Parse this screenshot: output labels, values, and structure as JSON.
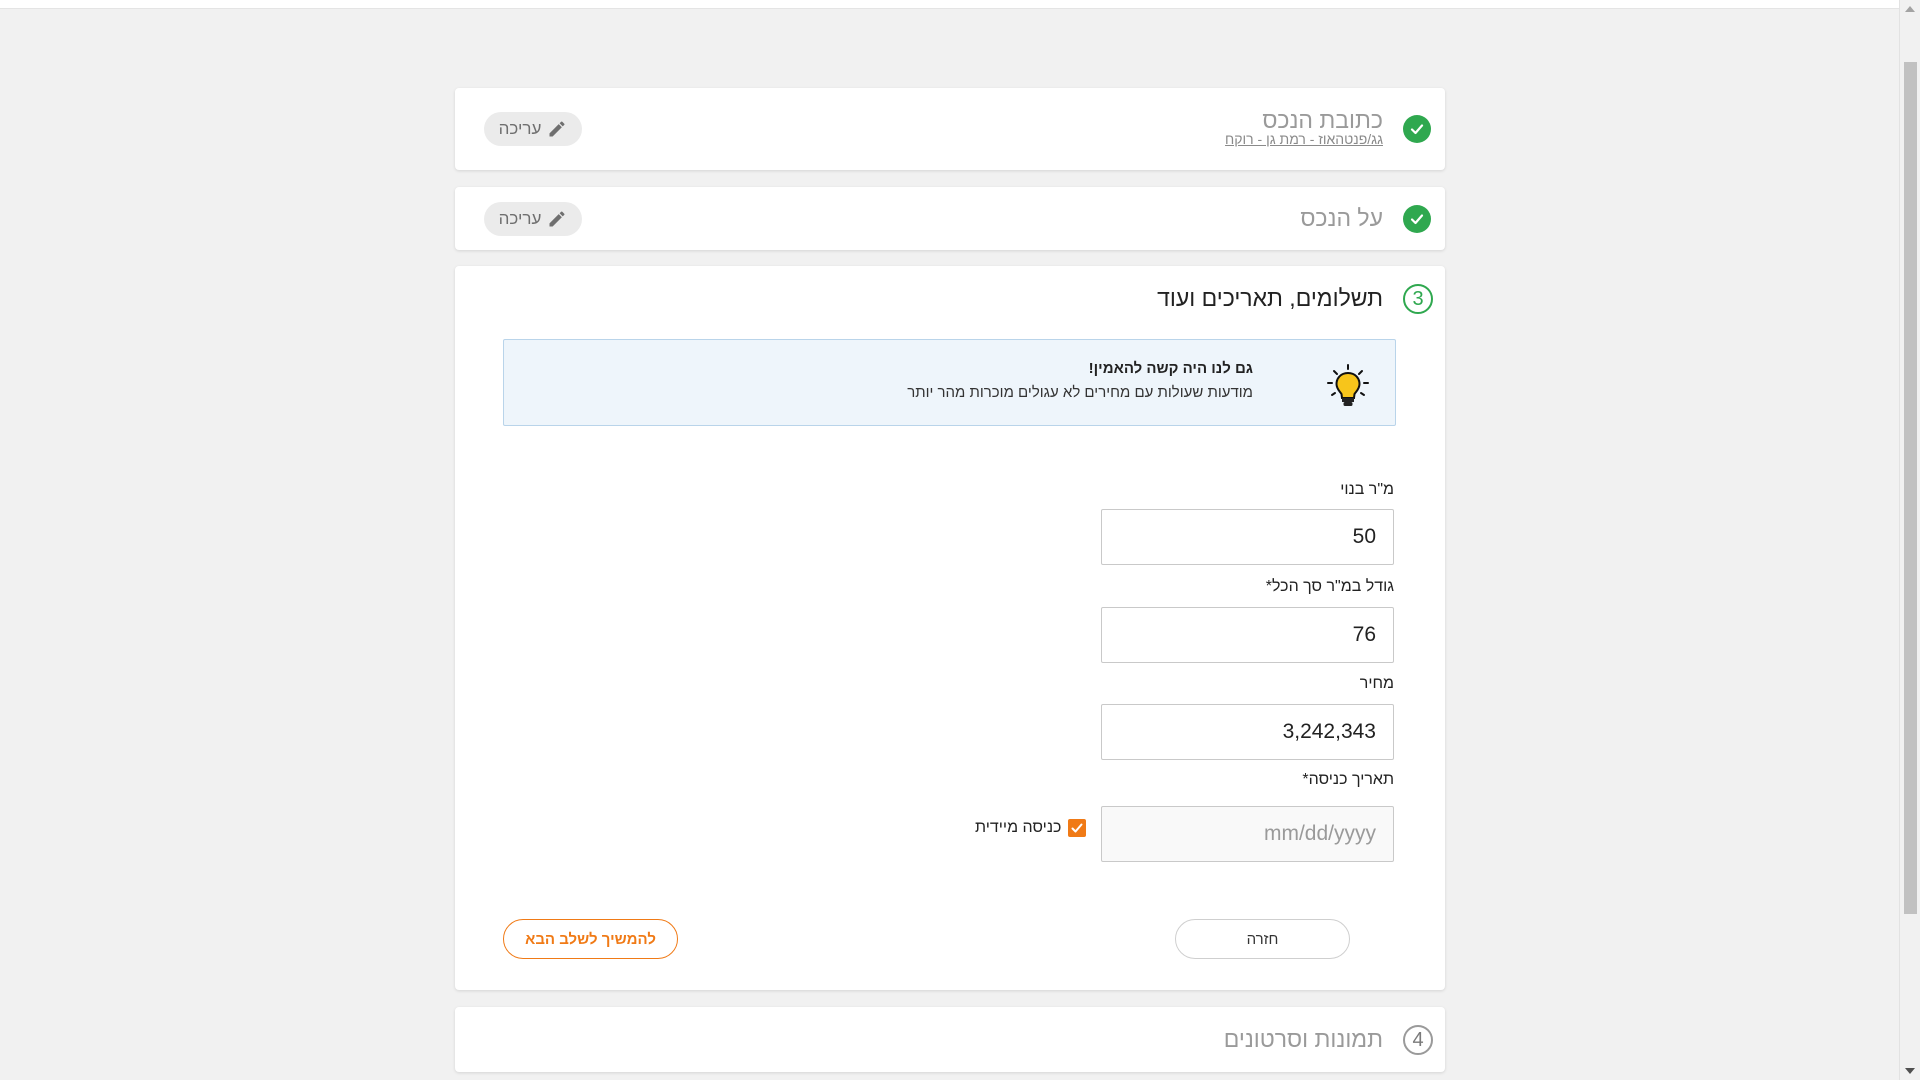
{
  "steps": {
    "address": {
      "title": "כתובת הנכס",
      "subtitle": "גג/פנטהאוז - רמת גן - רוקח",
      "edit_label": "עריכה",
      "status": "completed"
    },
    "about": {
      "title": "על הנכס",
      "edit_label": "עריכה",
      "status": "completed"
    },
    "payments": {
      "number": "3",
      "title": "תשלומים, תאריכים ועוד",
      "tip": {
        "title": "גם לנו היה קשה להאמין!",
        "text": "מודעות שעולות עם מחירים לא עגולים מוכרות מהר יותר"
      },
      "fields": {
        "built_sqm": {
          "label": "מ\"ר בנוי",
          "value": "50"
        },
        "total_sqm": {
          "label": "גודל במ\"ר סך הכל*",
          "value": "76"
        },
        "price": {
          "label": "מחיר",
          "value": "3,242,343"
        },
        "entry_date": {
          "label": "תאריך כניסה*",
          "placeholder": "mm/dd/yyyy",
          "value": ""
        }
      },
      "immediate_entry": {
        "label": "כניסה מיידית",
        "checked": true
      },
      "back_label": "חזרה",
      "next_label": "להמשיך לשלב הבא"
    },
    "media": {
      "number": "4",
      "title": "תמונות וסרטונים"
    }
  },
  "colors": {
    "accent": "#f07a16",
    "success": "#2fa84f",
    "tip_bg": "#eef5fb",
    "tip_border": "#b9d4ea"
  }
}
